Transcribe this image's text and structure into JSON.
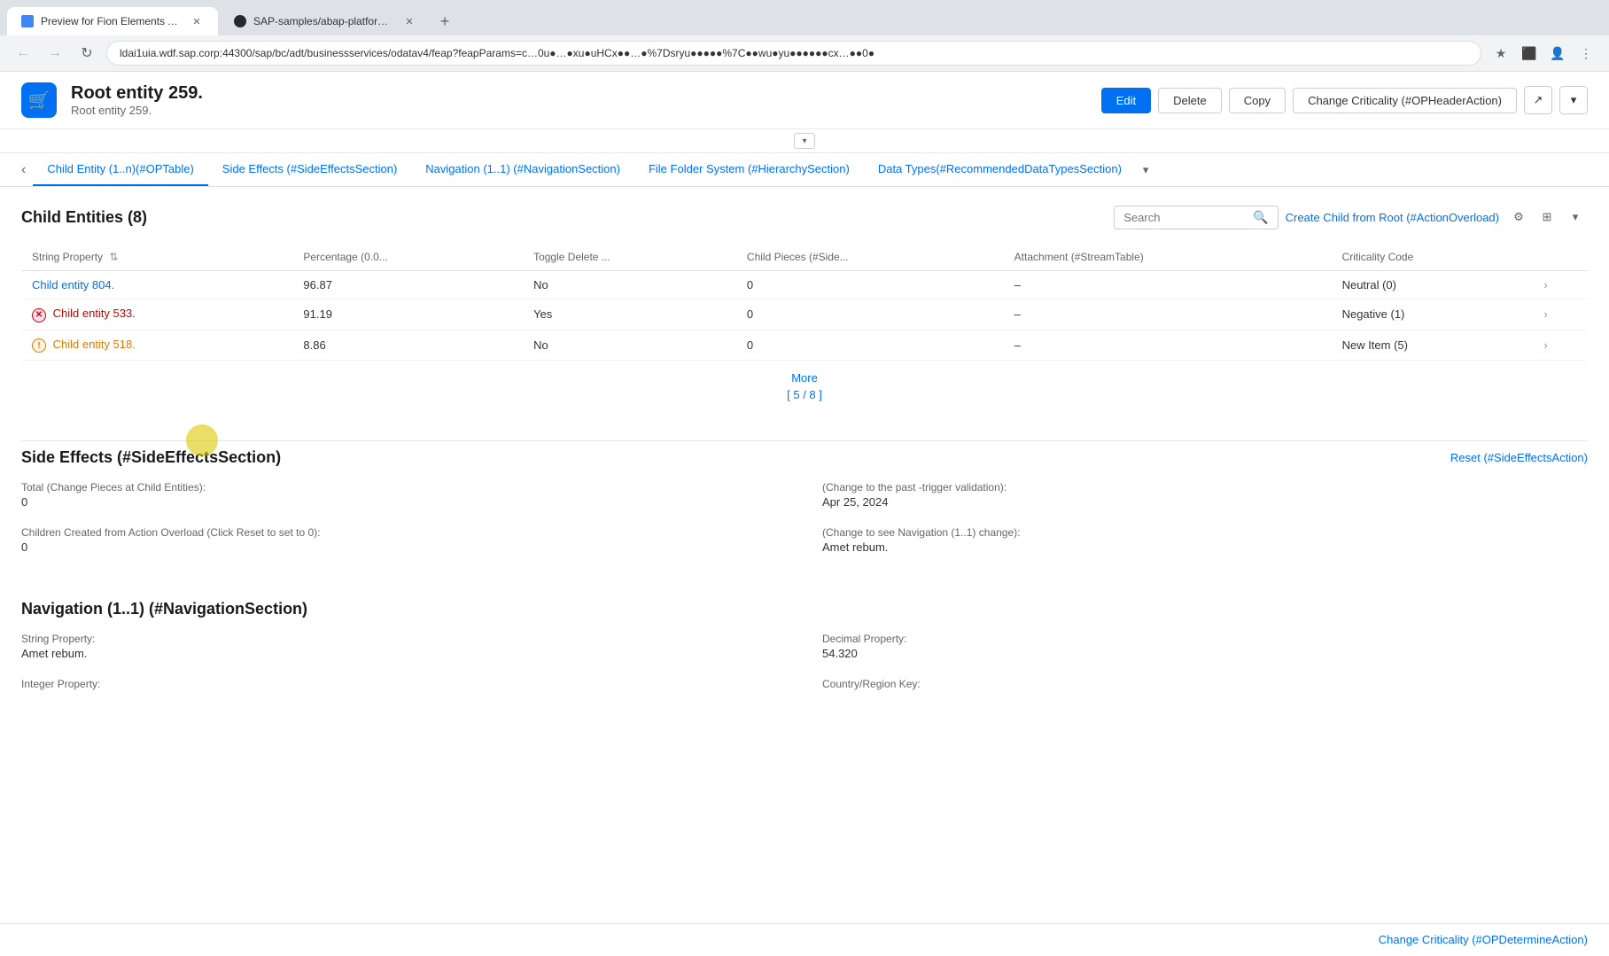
{
  "browser": {
    "tabs": [
      {
        "id": "tab1",
        "favicon": "app",
        "label": "Preview for Fion Elements App",
        "active": true
      },
      {
        "id": "tab2",
        "favicon": "gh",
        "label": "SAP-samples/abap-platform-fi...",
        "active": false
      }
    ],
    "address": "ldai1uia.wdf.sap.corp:44300/sap/bc/adt/businessservices/odatav4/feap?feapParams=c…0u●…●xu●uHCx●●…●%7Dsryu●●●●●%7C●●wu●yu●●●●●●cx…●●0●"
  },
  "header": {
    "logo_icon": "📦",
    "title": "Root entity 259.",
    "subtitle": "Root entity 259.",
    "actions": {
      "edit_label": "Edit",
      "delete_label": "Delete",
      "copy_label": "Copy",
      "change_criticality_label": "Change Criticality (#OPHeaderAction)"
    }
  },
  "tab_nav": {
    "items": [
      {
        "id": "t1",
        "label": "Child Entity (1..n)(#OPTable)",
        "active": true
      },
      {
        "id": "t2",
        "label": "Side Effects (#SideEffectsSection)",
        "active": false
      },
      {
        "id": "t3",
        "label": "Navigation (1..1) (#NavigationSection)",
        "active": false
      },
      {
        "id": "t4",
        "label": "File Folder System (#HierarchySection)",
        "active": false
      },
      {
        "id": "t5",
        "label": "Data Types(#RecommendedDataTypesSection)",
        "active": false
      }
    ]
  },
  "child_entities": {
    "section_title": "Child Entities (8)",
    "search_placeholder": "Search",
    "create_link": "Create Child from Root (#ActionOverload)",
    "columns": [
      {
        "id": "string_property",
        "label": "String Property"
      },
      {
        "id": "percentage",
        "label": "Percentage (0.0..."
      },
      {
        "id": "toggle_delete",
        "label": "Toggle Delete ..."
      },
      {
        "id": "child_pieces",
        "label": "Child Pieces (#Side..."
      },
      {
        "id": "attachment",
        "label": "Attachment (#StreamTable)"
      },
      {
        "id": "criticality_code",
        "label": "Criticality Code"
      }
    ],
    "rows": [
      {
        "id": "r1",
        "string_property": "Child entity 804.",
        "badge": null,
        "percentage": "96.87",
        "toggle_delete": "No",
        "child_pieces": "0",
        "attachment": "–",
        "criticality_code": "Neutral (0)"
      },
      {
        "id": "r2",
        "string_property": "Child entity 533.",
        "badge": "error",
        "percentage": "91.19",
        "toggle_delete": "Yes",
        "child_pieces": "0",
        "attachment": "–",
        "criticality_code": "Negative (1)"
      },
      {
        "id": "r3",
        "string_property": "Child entity 518.",
        "badge": "warn",
        "percentage": "8.86",
        "toggle_delete": "No",
        "child_pieces": "0",
        "attachment": "–",
        "criticality_code": "New Item (5)"
      }
    ],
    "more_label": "More",
    "pagination": "[ 5 / 8 ]"
  },
  "side_effects": {
    "section_title": "Side Effects (#SideEffectsSection)",
    "reset_link": "Reset (#SideEffectsAction)",
    "fields": [
      {
        "label": "Total (Change Pieces at Child Entities):",
        "value": "0",
        "col": "left"
      },
      {
        "label": "(Change to the past -trigger validation):",
        "value": "Apr 25, 2024",
        "col": "right"
      },
      {
        "label": "Children Created from Action Overload (Click Reset to set to 0):",
        "value": "0",
        "col": "left"
      },
      {
        "label": "(Change to see Navigation (1..1) change):",
        "value": "Amet rebum.",
        "col": "right"
      }
    ]
  },
  "navigation_section": {
    "section_title": "Navigation (1..1) (#NavigationSection)",
    "fields": [
      {
        "label": "String Property:",
        "value": "Amet rebum.",
        "col": "left"
      },
      {
        "label": "Decimal Property:",
        "value": "54.320",
        "col": "right"
      },
      {
        "label": "Integer Property:",
        "value": "",
        "col": "left"
      },
      {
        "label": "Country/Region Key:",
        "value": "",
        "col": "right"
      }
    ]
  },
  "bottom_bar": {
    "action_label": "Change Criticality (#OPDetermineAction)"
  }
}
